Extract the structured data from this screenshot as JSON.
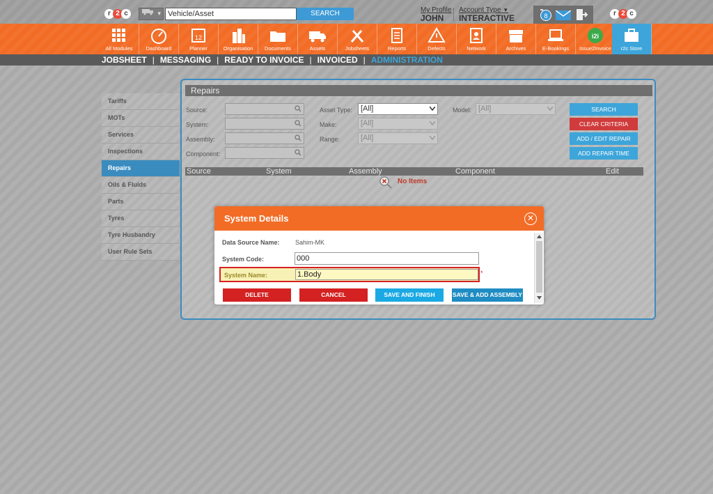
{
  "topbar": {
    "vehicle_input_placeholder": "Vehicle/Asset",
    "search_label": "SEARCH",
    "my_profile_label": "My Profile",
    "user_name": "JOHN",
    "account_type_label": "Account Type",
    "account_type_value": "INTERACTIVE",
    "notification_count": "8"
  },
  "nav": {
    "items": [
      {
        "label": "All Modules"
      },
      {
        "label": "Dashboard"
      },
      {
        "label": "Planner"
      },
      {
        "label": "Organisation"
      },
      {
        "label": "Documents"
      },
      {
        "label": "Assets"
      },
      {
        "label": "Jobsheets"
      },
      {
        "label": "Reports"
      },
      {
        "label": "Defects"
      },
      {
        "label": "Network"
      },
      {
        "label": "Archives"
      },
      {
        "label": "E-Bookings"
      },
      {
        "label": "Issue2Invoice"
      },
      {
        "label": "r2c Store"
      }
    ],
    "planner_day": "12",
    "i2i_badge": "i2i"
  },
  "subnav": {
    "items": [
      "JOBSHEET",
      "MESSAGING",
      "READY TO INVOICE",
      "INVOICED",
      "ADMINISTRATION"
    ],
    "separator": "|"
  },
  "sidemenu": {
    "items": [
      "Tariffs",
      "MOTs",
      "Services",
      "Inspections",
      "Repairs",
      "Oils & Fluids",
      "Parts",
      "Tyres",
      "Tyre Husbandry",
      "User Rule Sets"
    ]
  },
  "repairs": {
    "title": "Repairs",
    "labels": {
      "source": "Source:",
      "system": "System:",
      "assembly": "Assembly:",
      "component": "Component:",
      "asset_type": "Asset Type:",
      "make": "Make:",
      "range": "Range:",
      "model": "Model:"
    },
    "selects": {
      "asset_type": "[All]",
      "make": "[All]",
      "range": "[All]",
      "model": "[All]"
    },
    "buttons": {
      "search": "SEARCH",
      "clear": "CLEAR CRITERIA",
      "add_edit": "ADD / EDIT REPAIR",
      "add_time": "ADD REPAIR TIME"
    },
    "columns": [
      "Source",
      "System",
      "Assembly",
      "Component",
      "Edit"
    ],
    "empty_text": "No Items"
  },
  "modal": {
    "title": "System Details",
    "close_glyph": "✕",
    "data_source_label": "Data Source Name:",
    "data_source_value": "Sahim-MK",
    "system_code_label": "System Code:",
    "system_code_value": "000",
    "system_name_label": "System Name:",
    "system_name_value": "1.Body",
    "required_mark": "*",
    "buttons": {
      "delete": "DELETE",
      "cancel": "CANCEL",
      "save_finish": "SAVE AND FINISH",
      "save_add": "SAVE & ADD ASSEMBLY"
    }
  }
}
